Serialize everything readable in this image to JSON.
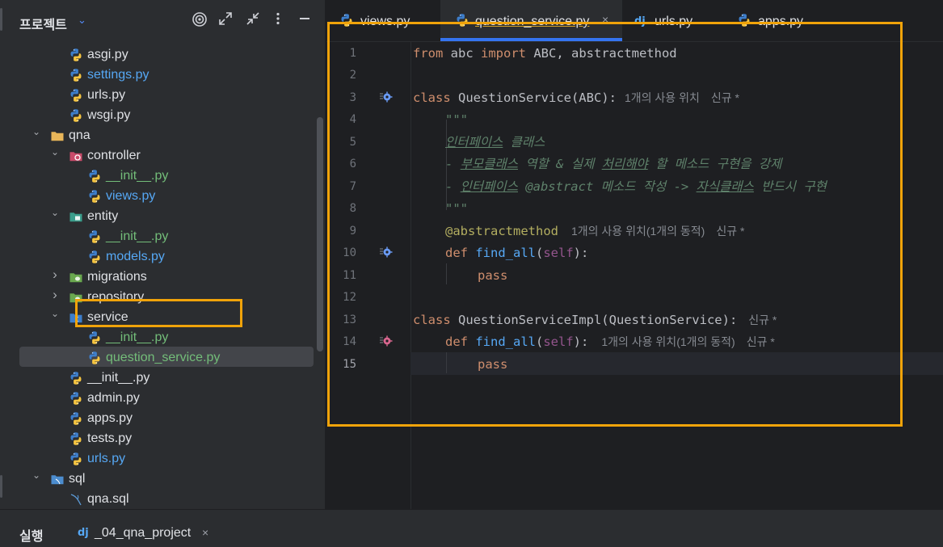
{
  "project_panel": {
    "title": "프로젝트",
    "header_icons": [
      "target-icon",
      "expand-icon",
      "collapse-icon",
      "more-icon",
      "minimize-icon"
    ],
    "tree": [
      {
        "label": "asgi.py",
        "type": "python",
        "color": "normal",
        "expanded": null
      },
      {
        "label": "settings.py",
        "type": "python",
        "color": "blue",
        "expanded": null
      },
      {
        "label": "urls.py",
        "type": "python",
        "color": "normal",
        "expanded": null
      },
      {
        "label": "wsgi.py",
        "type": "python",
        "color": "normal",
        "expanded": null
      },
      {
        "label": "qna",
        "type": "folder",
        "color": "normal",
        "expanded": true
      },
      {
        "label": "controller",
        "type": "package-controller",
        "color": "normal",
        "expanded": true
      },
      {
        "label": "__init__.py",
        "type": "python",
        "color": "green",
        "expanded": null
      },
      {
        "label": "views.py",
        "type": "python",
        "color": "blue",
        "expanded": null
      },
      {
        "label": "entity",
        "type": "package-entity",
        "color": "normal",
        "expanded": true
      },
      {
        "label": "__init__.py",
        "type": "python",
        "color": "green",
        "expanded": null
      },
      {
        "label": "models.py",
        "type": "python",
        "color": "blue",
        "expanded": null
      },
      {
        "label": "migrations",
        "type": "package-migrations",
        "color": "normal",
        "expanded": false
      },
      {
        "label": "repository",
        "type": "package-repository",
        "color": "normal",
        "expanded": false
      },
      {
        "label": "service",
        "type": "package-service",
        "color": "normal",
        "expanded": true
      },
      {
        "label": "__init__.py",
        "type": "python",
        "color": "green",
        "expanded": null
      },
      {
        "label": "question_service.py",
        "type": "python",
        "color": "green",
        "expanded": null,
        "selected": true
      },
      {
        "label": "__init__.py",
        "type": "python",
        "color": "normal",
        "expanded": null
      },
      {
        "label": "admin.py",
        "type": "python",
        "color": "normal",
        "expanded": null
      },
      {
        "label": "apps.py",
        "type": "python",
        "color": "normal",
        "expanded": null
      },
      {
        "label": "tests.py",
        "type": "python",
        "color": "normal",
        "expanded": null
      },
      {
        "label": "urls.py",
        "type": "python",
        "color": "blue",
        "expanded": null
      },
      {
        "label": "sql",
        "type": "folder-sql",
        "color": "normal",
        "expanded": true
      },
      {
        "label": "qna.sql",
        "type": "sql-file",
        "color": "normal",
        "expanded": null
      }
    ]
  },
  "tabs": [
    {
      "label": "views.py",
      "icon": "python-icon",
      "active": false
    },
    {
      "label": "question_service.py",
      "icon": "python-icon",
      "active": true,
      "close": "×"
    },
    {
      "label": "urls.py",
      "icon": "django-icon",
      "active": false
    },
    {
      "label": "apps.py",
      "icon": "python-icon",
      "active": false
    }
  ],
  "editor": {
    "line_numbers": [
      "1",
      "2",
      "3",
      "4",
      "5",
      "6",
      "7",
      "8",
      "9",
      "10",
      "11",
      "12",
      "13",
      "14",
      "15"
    ],
    "current_line": "15",
    "lines": {
      "l1": {
        "kw1": "from",
        "t1": " abc ",
        "kw2": "import",
        "t2": " ABC, abstractmethod"
      },
      "l3": {
        "kw": "class",
        "name": " QuestionService(ABC):",
        "hint": "1개의 사용 위치",
        "hint2": "신규 *"
      },
      "l4": {
        "doc": "\"\"\""
      },
      "l5": {
        "doc_u": "인터페이스",
        "doc": " 클래스"
      },
      "l6": {
        "d1": "- ",
        "u1": "부모클래스",
        "d2": " 역할 & 실제 ",
        "u2": "처리해야",
        "d3": " 할 메소드 구현을 강제"
      },
      "l7": {
        "d1": "- ",
        "u1": "인터페이스",
        "d2": " @abstract 메소드 작성 -> ",
        "u2": "자식클래스",
        "d3": " 반드시 구현"
      },
      "l8": {
        "doc": "\"\"\""
      },
      "l9": {
        "dec": "@abstractmethod",
        "hint": "1개의 사용 위치(1개의 동적)",
        "hint2": "신규 *"
      },
      "l10": {
        "kw": "def",
        "fn": " find_all",
        "p1": "(",
        "self": "self",
        "p2": "):"
      },
      "l11": {
        "kw": "pass"
      },
      "l13": {
        "kw": "class",
        "name": " QuestionServiceImpl(QuestionService):",
        "hint2": "신규 *"
      },
      "l14": {
        "kw": "def",
        "fn": " find_all",
        "p1": "(",
        "self": "self",
        "p2": "):",
        "hint": "1개의 사용 위치(1개의 동적)",
        "hint2": "신규 *"
      },
      "l15": {
        "kw": "pass"
      }
    }
  },
  "run_bar": {
    "title": "실행",
    "tab_label": "_04_qna_project",
    "tab_icon": "django-icon",
    "close": "×"
  },
  "colors": {
    "highlight": "#f0a30a",
    "keyword": "#cf8e6d",
    "function": "#56a8f5",
    "docstring": "#5f826b",
    "decorator": "#b3ae60",
    "self": "#94558d"
  }
}
